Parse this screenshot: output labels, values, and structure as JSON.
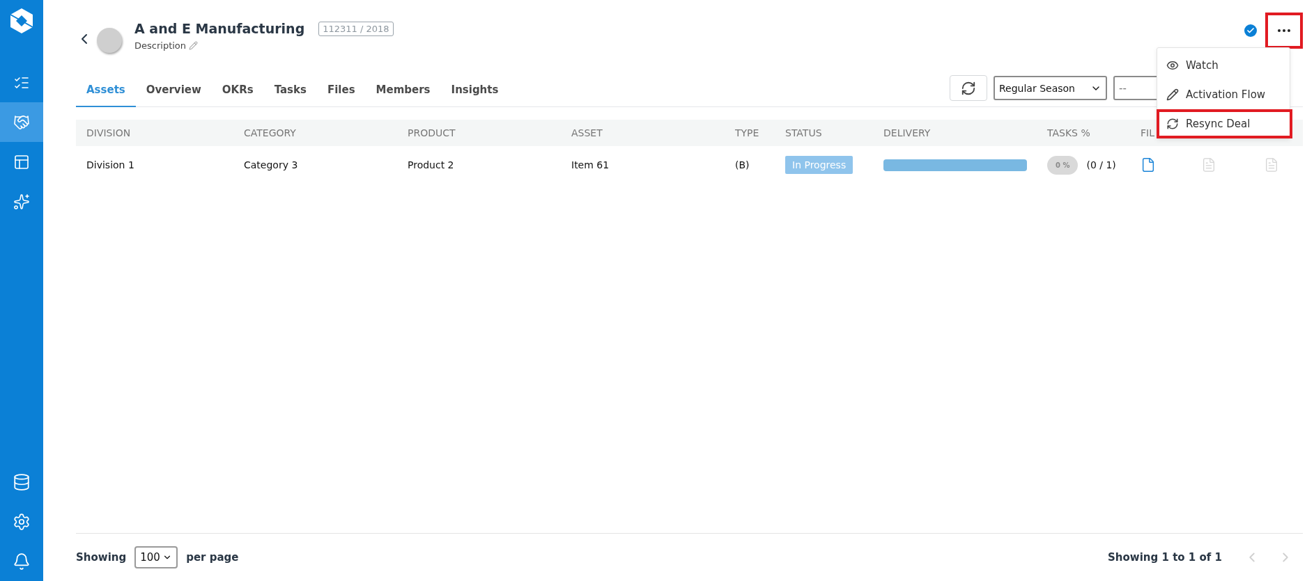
{
  "sidebar": {
    "items": [
      {
        "kind": "checklist",
        "selected": false
      },
      {
        "kind": "handshake",
        "selected": true
      },
      {
        "kind": "table",
        "selected": false
      },
      {
        "kind": "sparkle",
        "selected": false
      }
    ],
    "bottom_items": [
      {
        "kind": "database"
      },
      {
        "kind": "settings"
      },
      {
        "kind": "bell"
      }
    ]
  },
  "header": {
    "title": "A and E Manufacturing",
    "badge": "112311 / 2018",
    "description": "Description",
    "verified": true,
    "more_highlighted": true
  },
  "tabs": [
    {
      "label": "Assets",
      "selected": true
    },
    {
      "label": "Overview",
      "selected": false
    },
    {
      "label": "OKRs",
      "selected": false
    },
    {
      "label": "Tasks",
      "selected": false
    },
    {
      "label": "Files",
      "selected": false
    },
    {
      "label": "Members",
      "selected": false
    },
    {
      "label": "Insights",
      "selected": false
    }
  ],
  "filters": {
    "season": "Regular Season",
    "second": "--"
  },
  "menu": {
    "items": [
      {
        "kind": "watch",
        "label": "Watch",
        "highlighted": false
      },
      {
        "kind": "edit",
        "label": "Activation Flow",
        "highlighted": false
      },
      {
        "kind": "resync",
        "label": "Resync Deal",
        "highlighted": true
      }
    ]
  },
  "table": {
    "columns": [
      "DIVISION",
      "CATEGORY",
      "PRODUCT",
      "ASSET",
      "TYPE",
      "STATUS",
      "DELIVERY",
      "TASKS %",
      "FIL"
    ],
    "rows": [
      {
        "division": "Division 1",
        "category": "Category 3",
        "product": "Product 2",
        "asset": "Item 61",
        "type": "(B)",
        "status": "In Progress",
        "tasks_percent": "0 %",
        "tasks_count": "(0 / 1)"
      }
    ]
  },
  "footer": {
    "showing_label": "Showing",
    "page_size": "100",
    "per_page_label": "per page",
    "summary": "Showing 1 to 1 of 1"
  }
}
